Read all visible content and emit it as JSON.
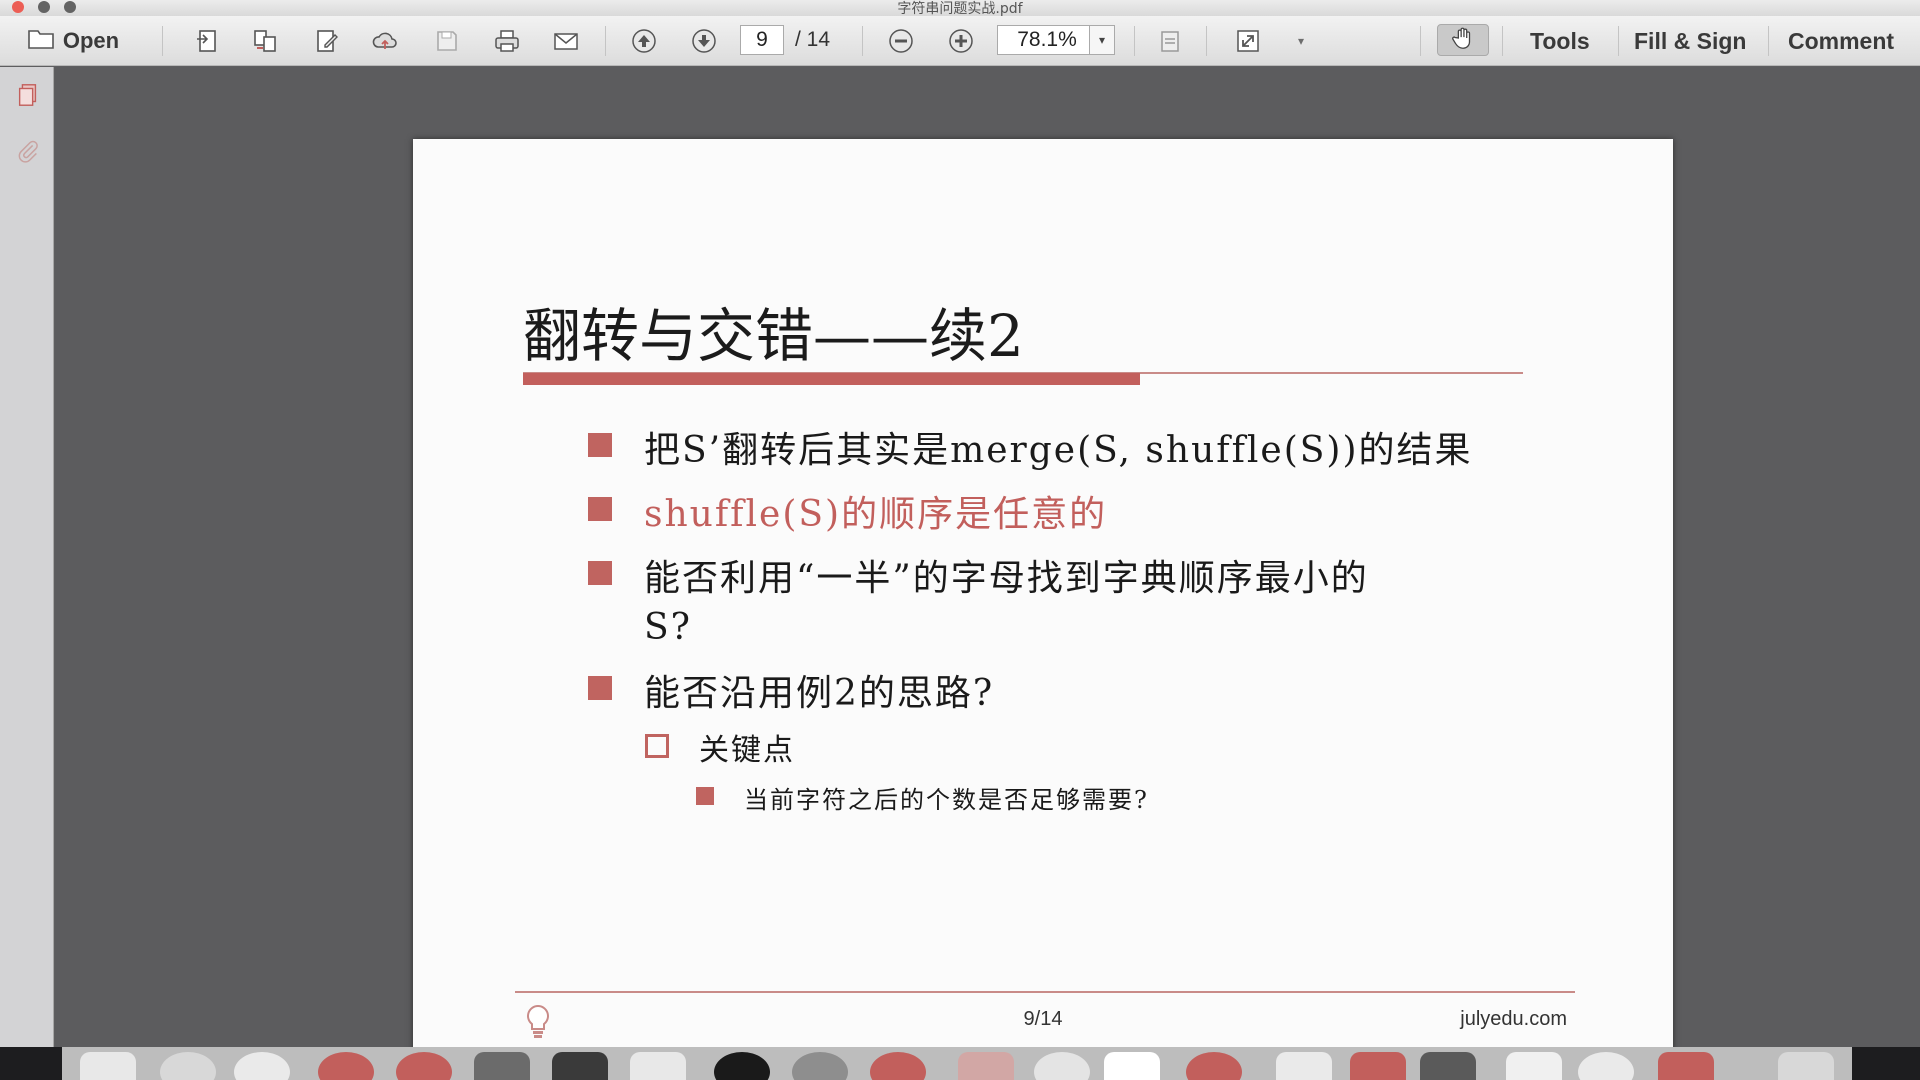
{
  "window": {
    "title": "字符串问题实战.pdf"
  },
  "toolbar": {
    "open_label": "Open",
    "current_page": "9",
    "total_pages": "/ 14",
    "zoom": "78.1%",
    "tools_label": "Tools",
    "fill_sign_label": "Fill & Sign",
    "comment_label": "Comment"
  },
  "slide": {
    "title": "翻转与交错——续2",
    "bullets": [
      {
        "text": "把S’翻转后其实是merge(S, shuffle(S))的结果"
      },
      {
        "text": "shuffle(S)的顺序是任意的"
      },
      {
        "text_line1": "能否利用“一半”的字母找到字典顺序最小的",
        "text_line2": "S?"
      },
      {
        "text": "能否沿用例2的思路?"
      }
    ],
    "sub_bullet": "关键点",
    "sub_sub_bullet": "当前字符之后的个数是否足够需要?",
    "footer_page": "9/14",
    "footer_site": "julyedu.com"
  },
  "colors": {
    "accent": "#c25f5c",
    "toolbar_bg": "#e6e6e6",
    "doc_bg": "#5c5c5e",
    "sidebar_bg": "#d3d3d5"
  }
}
